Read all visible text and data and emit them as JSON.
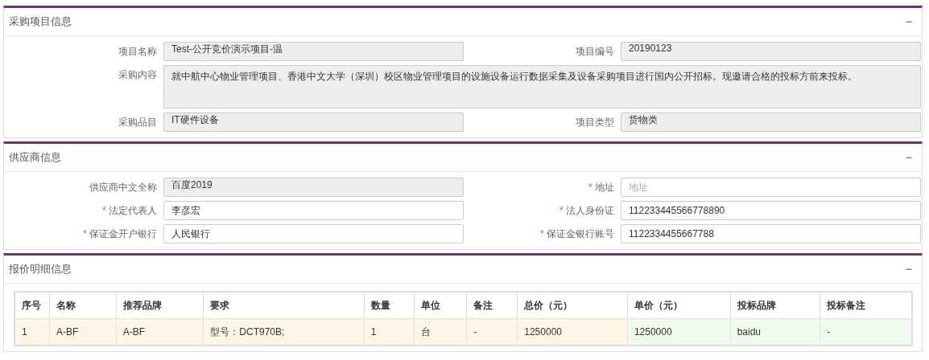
{
  "panels": [
    {
      "kind": "form",
      "title": "采购项目信息",
      "collapse_icon": "−",
      "fields": [
        {
          "label": "项目名称",
          "value": "Test-公开竞价演示项目-温",
          "readonly": true,
          "multiline": false
        },
        {
          "label": "项目编号",
          "value": "20190123",
          "readonly": true,
          "multiline": false
        },
        {
          "label": "采购内容",
          "value": "就中航中心物业管理项目、香港中文大学（深圳）校区物业管理项目的设施设备运行数据采集及设备采购项目进行国内公开招标。现邀请合格的投标方前来投标。",
          "readonly": true,
          "multiline": true
        },
        {
          "label": "采购品目",
          "value": "IT硬件设备",
          "readonly": true,
          "multiline": false
        },
        {
          "label": "项目类型",
          "value": "货物类",
          "readonly": true,
          "multiline": false
        }
      ]
    },
    {
      "kind": "form",
      "title": "供应商信息",
      "collapse_icon": "−",
      "fields": [
        {
          "label": "供应商中文全称",
          "value": "百度2019",
          "readonly": true,
          "multiline": false
        },
        {
          "label": "地址",
          "required_mark": "*",
          "placeholder": "地址",
          "readonly": false,
          "multiline": false
        },
        {
          "label": "法定代表人",
          "required_mark": "*",
          "value": "李彦宏",
          "readonly": false,
          "multiline": false
        },
        {
          "label": "法人身份证",
          "required_mark": "*",
          "value": "112233445566778890",
          "readonly": false,
          "multiline": false
        },
        {
          "label": "保证金开户银行",
          "required_mark": "*",
          "value": "人民银行",
          "readonly": false,
          "multiline": false
        },
        {
          "label": "保证金银行账号",
          "required_mark": "*",
          "value": "1122334455667788",
          "readonly": false,
          "multiline": false
        }
      ]
    },
    {
      "kind": "table",
      "title": "报价明细信息",
      "collapse_icon": "−",
      "columns": [
        {
          "label": "序号",
          "kind": "requested"
        },
        {
          "label": "名称",
          "kind": "requested"
        },
        {
          "label": "推荐品牌",
          "kind": "requested"
        },
        {
          "label": "要求",
          "kind": "requested"
        },
        {
          "label": "数量",
          "kind": "requested"
        },
        {
          "label": "单位",
          "kind": "requested"
        },
        {
          "label": "备注",
          "kind": "requested"
        },
        {
          "label": "总价（元）",
          "kind": "requested"
        },
        {
          "label": "单价（元）",
          "kind": "bid"
        },
        {
          "label": "投标品牌",
          "kind": "bid"
        },
        {
          "label": "投标备注",
          "kind": "bid"
        }
      ],
      "rows": [
        [
          "1",
          "A-BF",
          "A-BF",
          "型号：DCT970B;",
          "1",
          "台",
          "-",
          "1250000",
          "1250000",
          "baidu",
          "-"
        ]
      ]
    }
  ]
}
